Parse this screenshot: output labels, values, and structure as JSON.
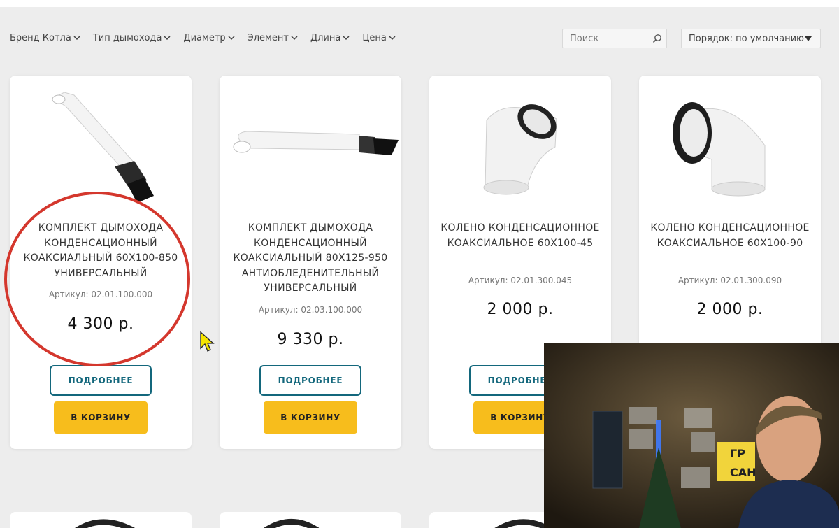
{
  "filters": [
    "Бренд Котла",
    "Тип дымохода",
    "Диаметр",
    "Элемент",
    "Длина",
    "Цена"
  ],
  "search": {
    "placeholder": "Поиск"
  },
  "sort": {
    "label": "Порядок: по умолчанию"
  },
  "products": [
    {
      "title": "КОМПЛЕКТ ДЫМОХОДА КОНДЕНСАЦИОННЫЙ КОАКСИАЛЬНЫЙ 60Х100-850 УНИВЕРСАЛЬНЫЙ",
      "sku": "Артикул: 02.01.100.000",
      "price": "4 300 р.",
      "more_label": "ПОДРОБНЕЕ",
      "cart_label": "В КОРЗИНУ"
    },
    {
      "title": "КОМПЛЕКТ ДЫМОХОДА КОНДЕНСАЦИОННЫЙ КОАКСИАЛЬНЫЙ 80Х125-950 АНТИОБЛЕДЕНИТЕЛЬНЫЙ УНИВЕРСАЛЬНЫЙ",
      "sku": "Артикул: 02.03.100.000",
      "price": "9 330 р.",
      "more_label": "ПОДРОБНЕЕ",
      "cart_label": "В КОРЗИНУ"
    },
    {
      "title": "КОЛЕНО КОНДЕНСАЦИОННОЕ КОАКСИАЛЬНОЕ 60Х100-45",
      "sku": "Артикул: 02.01.300.045",
      "price": "2 000 р.",
      "more_label": "ПОДРОБНЕЕ",
      "cart_label": "В КОРЗИНУ"
    },
    {
      "title": "КОЛЕНО КОНДЕНСАЦИОННОЕ КОАКСИАЛЬНОЕ 60Х100-90",
      "sku": "Артикул: 02.01.300.090",
      "price": "2 000 р."
    }
  ],
  "webcam": {
    "sign_text_1": "ГР",
    "sign_text_2": "САН"
  },
  "colors": {
    "accent_teal": "#13677c",
    "cart_yellow": "#f7bd1c",
    "highlight_red": "#d4372d"
  }
}
